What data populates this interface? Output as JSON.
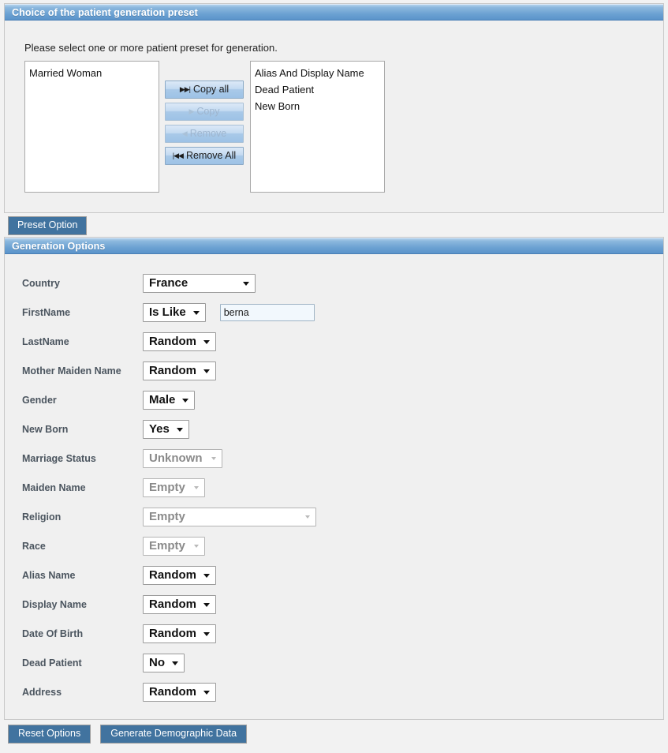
{
  "preset_panel": {
    "title": "Choice of the patient generation preset",
    "instruction": "Please select one or more patient preset for generation.",
    "available_list": {
      "name": "available-presets",
      "items": [
        "Married Woman"
      ]
    },
    "selected_list": {
      "name": "selected-presets",
      "items": [
        "Alias And Display Name",
        "Dead Patient",
        "New Born"
      ]
    },
    "transfer_buttons": [
      {
        "label": "Copy all",
        "icon": "skip-forward-icon",
        "glyph": "▶▶|",
        "enabled": true
      },
      {
        "label": "Copy",
        "icon": "play-right-icon",
        "glyph": "▶",
        "enabled": false
      },
      {
        "label": "Remove",
        "icon": "play-left-icon",
        "glyph": "◀",
        "enabled": false
      },
      {
        "label": "Remove All",
        "icon": "skip-back-icon",
        "glyph": "|◀◀",
        "enabled": true
      }
    ],
    "preset_option_label": "Preset Option"
  },
  "generation_panel": {
    "title": "Generation Options",
    "rows": [
      {
        "label": "Country",
        "value": "France",
        "enabled": true,
        "width": "country",
        "text_input": null
      },
      {
        "label": "FirstName",
        "value": "Is Like",
        "enabled": true,
        "width": "auto",
        "text_input": {
          "value": "berna",
          "placeholder": ""
        }
      },
      {
        "label": "LastName",
        "value": "Random",
        "enabled": true,
        "width": "auto",
        "text_input": null
      },
      {
        "label": "Mother Maiden Name",
        "value": "Random",
        "enabled": true,
        "width": "auto",
        "text_input": null
      },
      {
        "label": "Gender",
        "value": "Male",
        "enabled": true,
        "width": "auto",
        "text_input": null
      },
      {
        "label": "New Born",
        "value": "Yes",
        "enabled": true,
        "width": "auto",
        "text_input": null
      },
      {
        "label": "Marriage Status",
        "value": "Unknown",
        "enabled": false,
        "width": "auto",
        "text_input": null
      },
      {
        "label": "Maiden Name",
        "value": "Empty",
        "enabled": false,
        "width": "auto",
        "text_input": null
      },
      {
        "label": "Religion",
        "value": "Empty",
        "enabled": false,
        "width": "wide",
        "text_input": null
      },
      {
        "label": "Race",
        "value": "Empty",
        "enabled": false,
        "width": "auto",
        "text_input": null
      },
      {
        "label": "Alias Name",
        "value": "Random",
        "enabled": true,
        "width": "auto",
        "text_input": null
      },
      {
        "label": "Display Name",
        "value": "Random",
        "enabled": true,
        "width": "auto",
        "text_input": null
      },
      {
        "label": "Date Of Birth",
        "value": "Random",
        "enabled": true,
        "width": "auto",
        "text_input": null
      },
      {
        "label": "Dead Patient",
        "value": "No",
        "enabled": true,
        "width": "auto",
        "text_input": null
      },
      {
        "label": "Address",
        "value": "Random",
        "enabled": true,
        "width": "auto",
        "text_input": null
      }
    ]
  },
  "footer": {
    "reset_label": "Reset Options",
    "generate_label": "Generate Demographic Data"
  },
  "colors": {
    "header_gradient_top": "#b4d2ec",
    "header_gradient_bottom": "#5b94cb",
    "steel_button": "#41739f",
    "panel_body": "#f0f0f0",
    "page_background": "#f2f2f2",
    "label_text": "#4b555f",
    "input_background": "#f2f8fd"
  }
}
